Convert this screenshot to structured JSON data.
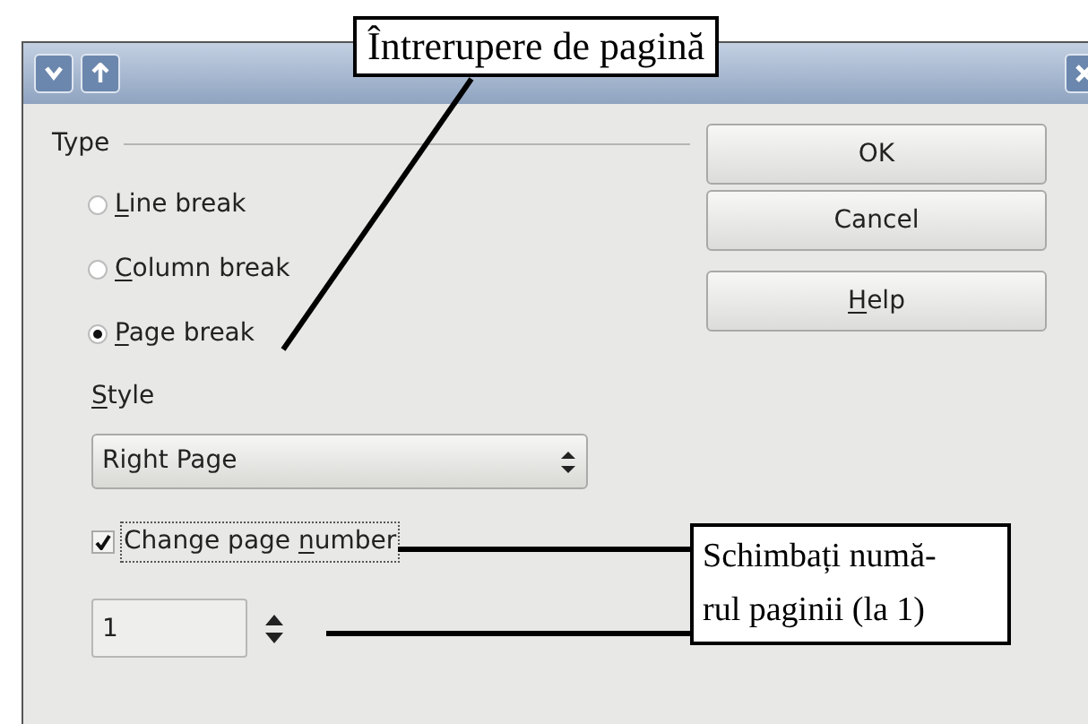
{
  "type_group": {
    "label": "Type",
    "options": [
      {
        "key": "L",
        "post": "ine break",
        "selected": false
      },
      {
        "key": "C",
        "post": "olumn break",
        "selected": false
      },
      {
        "key": "P",
        "post": "age break",
        "selected": true
      }
    ]
  },
  "style": {
    "label": {
      "key": "S",
      "post": "tyle"
    },
    "value": "Right Page"
  },
  "change_page_number": {
    "label": {
      "pre": "Change page ",
      "key": "n",
      "post": "umber"
    },
    "checked": true,
    "focused": true
  },
  "page_number": {
    "value": "1"
  },
  "buttons": [
    {
      "pre": "OK"
    },
    {
      "pre": "Cancel"
    },
    {
      "key": "H",
      "post": "elp"
    }
  ],
  "callouts": [
    {
      "lines": [
        "Întrerupere de pagină"
      ]
    },
    {
      "lines": [
        "Schimbați numă-",
        "rul paginii (la 1)"
      ]
    }
  ]
}
